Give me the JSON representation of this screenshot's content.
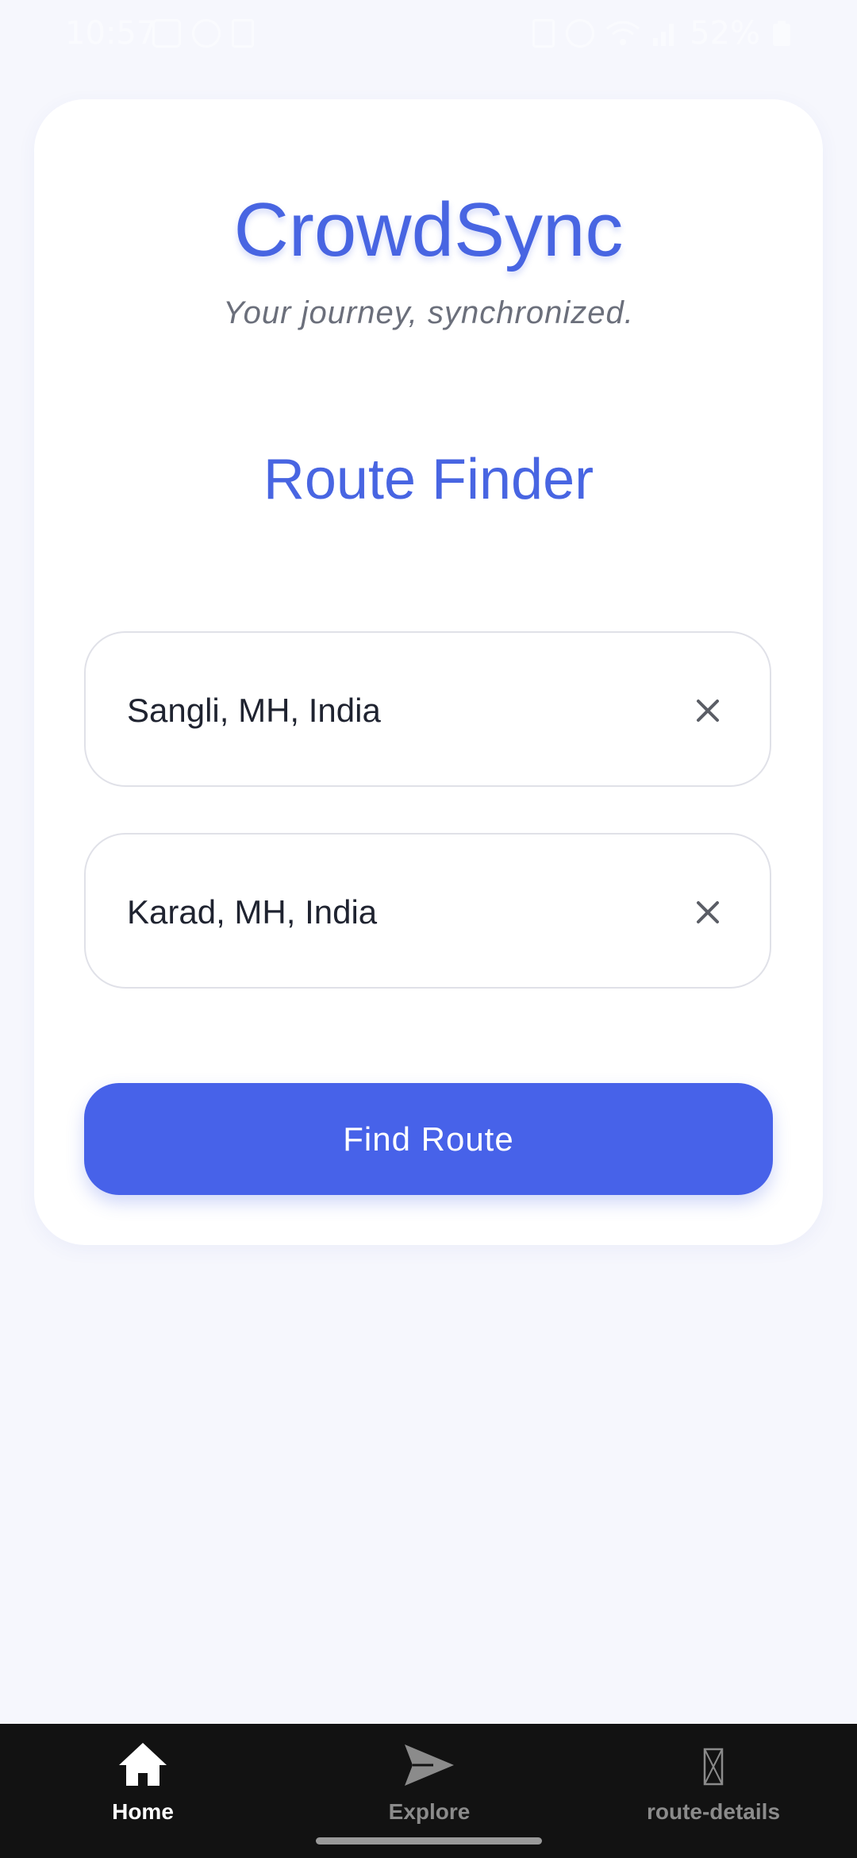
{
  "status_bar": {
    "time": "10:57",
    "battery": "52%",
    "icons": [
      "gallery-icon",
      "app-icon",
      "data-icon",
      "sim-icon",
      "alarm-icon",
      "wifi-icon",
      "signal-icon",
      "battery-icon"
    ]
  },
  "app": {
    "title": "CrowdSync",
    "tagline": "Your journey, synchronized."
  },
  "route_finder": {
    "title": "Route Finder",
    "origin_value": "Sangli, MH, India",
    "destination_value": "Karad, MH, India",
    "clear_icon": "close-icon",
    "submit_label": "Find Route"
  },
  "bottom_nav": {
    "items": [
      {
        "label": "Home",
        "icon": "home-icon",
        "active": true
      },
      {
        "label": "Explore",
        "icon": "send-icon",
        "active": false
      },
      {
        "label": "route-details",
        "icon": "missing-glyph-icon",
        "active": false
      }
    ]
  },
  "colors": {
    "accent": "#4865e2",
    "button": "#4762e9",
    "background": "#f6f7fd",
    "card": "#ffffff",
    "nav_background": "#121212"
  }
}
